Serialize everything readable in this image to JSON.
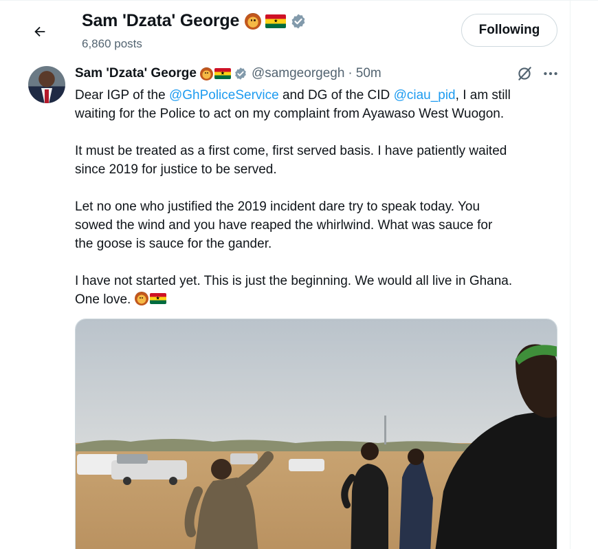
{
  "header": {
    "back_label": "Back",
    "name": "Sam 'Dzata' George",
    "post_count": "6,860 posts",
    "follow_label": "Following"
  },
  "tweet": {
    "author_name": "Sam 'Dzata' George",
    "handle": "@samgeorgegh",
    "separator": "·",
    "time": "50m",
    "paragraphs": {
      "p1_a": "Dear IGP of the ",
      "p1_mention1": "@GhPoliceService",
      "p1_b": " and DG of the CID ",
      "p1_mention2": "@ciau_pid",
      "p1_c": ", I am still",
      "p1_line2": "waiting for the Police to act on my complaint from Ayawaso West Wuogon.",
      "p2_line1": "It must be treated as a first come, first served basis. I have patiently waited",
      "p2_line2": "since 2019 for justice to be served.",
      "p3_line1": "Let no one who justified the 2019 incident dare try to speak today. You",
      "p3_line2": "sowed the wind and you have reaped the whirlwind. What was sauce for",
      "p3_line3": "the goose is sauce for the gander.",
      "p4_line1": "I have not started yet. This is just the beginning. We would all live in Ghana.",
      "p4_line2": "One love. "
    }
  },
  "icons": {
    "back": "arrow-left-icon",
    "verified": "verified-badge-icon",
    "grok": "grok-icon",
    "more": "more-icon",
    "lion": "lion-emoji",
    "flag": "ghana-flag-emoji"
  },
  "colors": {
    "link": "#1d9bf0",
    "secondary_text": "#536471",
    "verified_badge": "#829aab",
    "border": "#cfd9de"
  }
}
